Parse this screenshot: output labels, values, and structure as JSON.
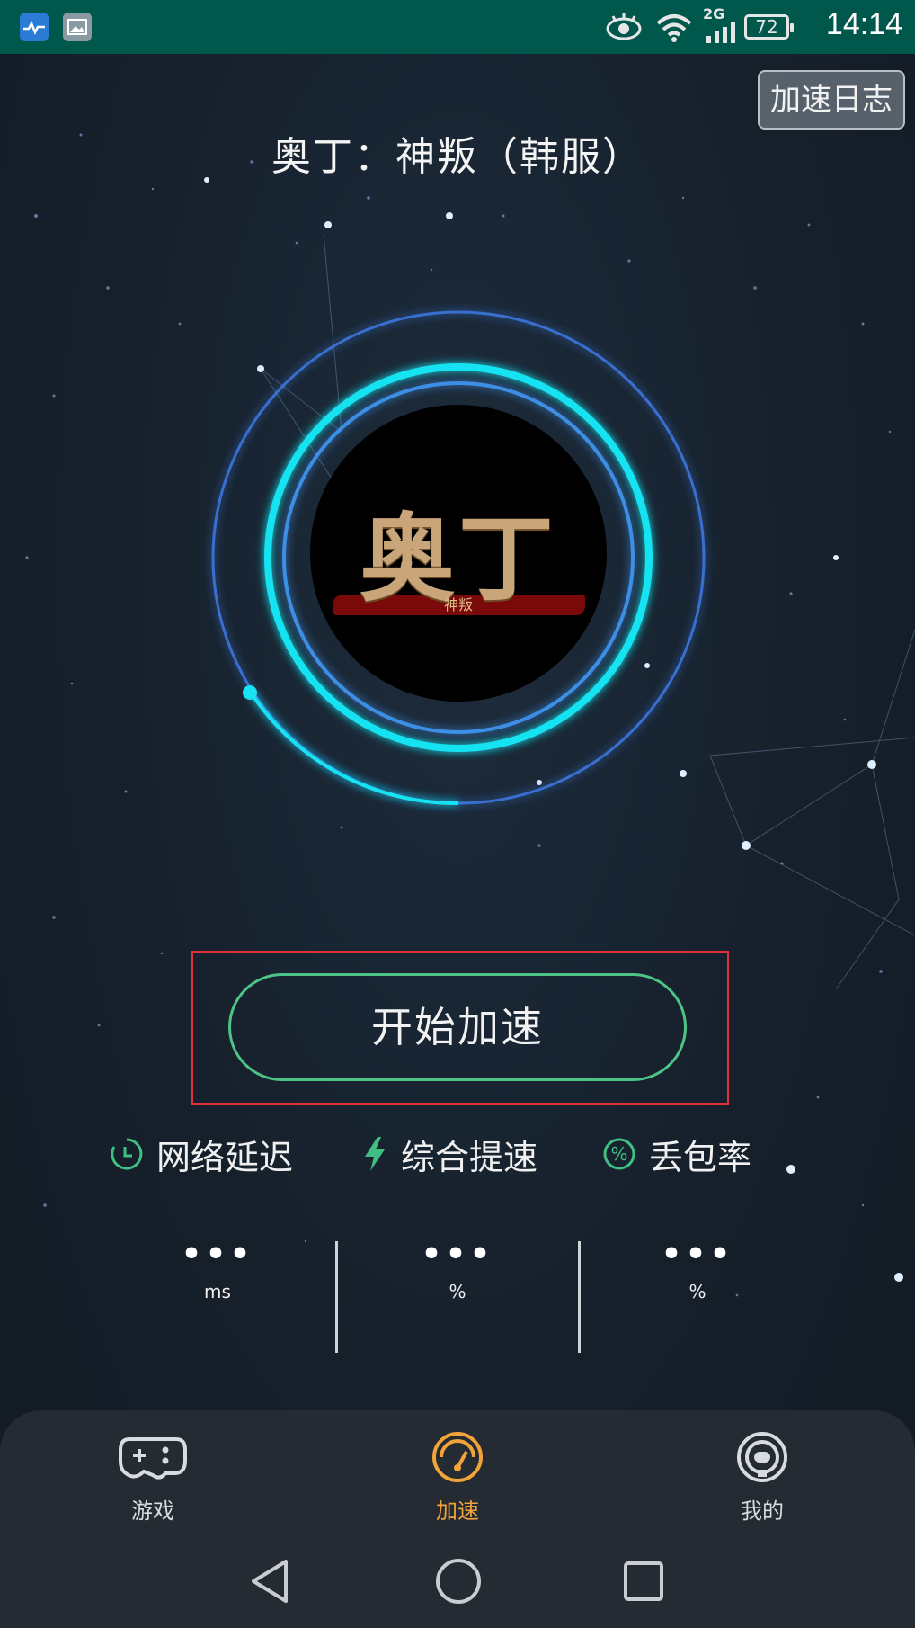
{
  "status_bar": {
    "time": "14:14",
    "battery": "72",
    "network": "2G",
    "icons": [
      "health-app-icon",
      "gallery-icon",
      "eye-comfort-icon",
      "wifi-icon",
      "signal-icon",
      "battery-icon"
    ]
  },
  "header": {
    "log_button": "加速日志",
    "game_title": "奥丁：神叛（韩服）"
  },
  "game_logo": {
    "main_text": "奥丁",
    "sub_text": "神叛"
  },
  "start_button": "开始加速",
  "metrics": [
    {
      "label": "网络延迟",
      "icon": "clock-icon",
      "value": "•••",
      "unit": "ms"
    },
    {
      "label": "综合提速",
      "icon": "lightning-icon",
      "value": "•••",
      "unit": "%"
    },
    {
      "label": "丢包率",
      "icon": "percent-icon",
      "value": "•••",
      "unit": "%"
    }
  ],
  "bottom_nav": [
    {
      "label": "游戏",
      "icon": "gamepad-icon",
      "active": false
    },
    {
      "label": "加速",
      "icon": "speedometer-icon",
      "active": true
    },
    {
      "label": "我的",
      "icon": "profile-icon",
      "active": false
    }
  ],
  "colors": {
    "status_bar": "#00574b",
    "accent_green": "#4dc386",
    "active_orange": "#f2a33a",
    "ring_cyan": "#19e3f2",
    "ring_blue": "#3d78e0",
    "highlight_red": "#e0303a"
  },
  "system_nav": [
    "back-icon",
    "home-icon",
    "recents-icon"
  ]
}
